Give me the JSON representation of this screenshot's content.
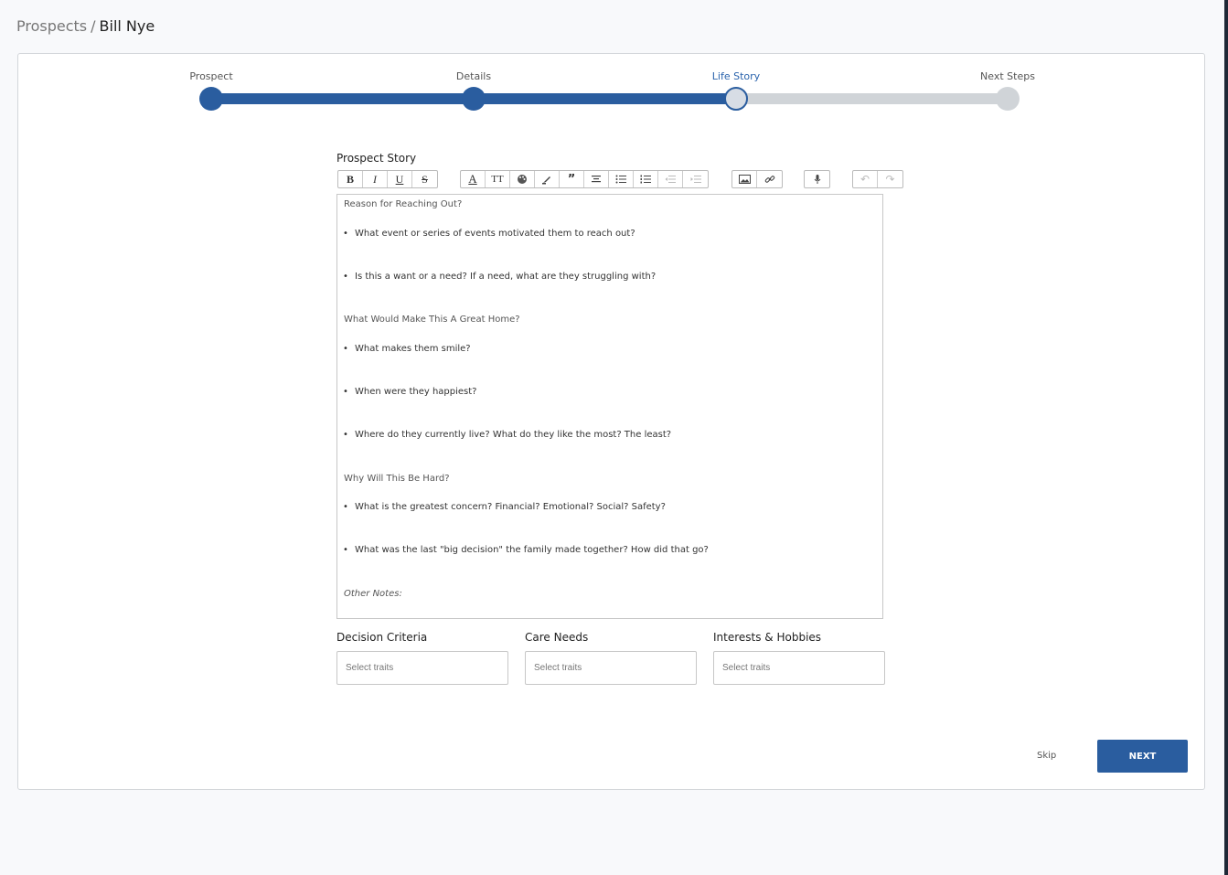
{
  "breadcrumb": {
    "root": "Prospects",
    "separator": "/",
    "current": "Bill Nye"
  },
  "stepper": {
    "steps": [
      {
        "label": "Prospect",
        "state": "done"
      },
      {
        "label": "Details",
        "state": "done"
      },
      {
        "label": "Life Story",
        "state": "current"
      },
      {
        "label": "Next Steps",
        "state": "todo"
      }
    ]
  },
  "editor": {
    "label": "Prospect Story",
    "toolbar": {
      "icons": [
        "bold-icon",
        "italic-icon",
        "underline-icon",
        "strikethrough-icon",
        "font-icon",
        "font-size-icon",
        "color-palette-icon",
        "highlight-icon",
        "blockquote-icon",
        "align-center-icon",
        "bulleted-list-icon",
        "numbered-list-icon",
        "outdent-icon",
        "indent-icon",
        "image-icon",
        "link-icon",
        "microphone-icon",
        "undo-icon",
        "redo-icon"
      ]
    },
    "content": {
      "heading_1": "Reason for Reaching Out?",
      "item_1": "What event or series of events motivated them to reach out?",
      "item_2": "Is this a want or a need?  If a need, what are they struggling with?",
      "heading_2": "What Would Make This A Great Home?",
      "item_3": "What makes them smile?",
      "item_4": "When were they happiest?",
      "item_5": "Where do they currently live?  What do they like the most?  The least?",
      "heading_3": "Why Will This Be Hard?",
      "item_6": "What is the greatest concern?  Financial?  Emotional?  Social?  Safety?",
      "item_7": "What was the last \"big decision\" the family made together?  How did that go?",
      "other_notes": "Other Notes:"
    }
  },
  "traits": {
    "decision_criteria": {
      "label": "Decision Criteria",
      "placeholder": "Select traits"
    },
    "care_needs": {
      "label": "Care Needs",
      "placeholder": "Select traits"
    },
    "interests": {
      "label": "Interests & Hobbies",
      "placeholder": "Select traits"
    }
  },
  "actions": {
    "skip": "Skip",
    "next": "NEXT"
  },
  "colors": {
    "accent": "#2a5d9f",
    "track_inactive": "#d0d4d8",
    "border": "#c7c7c7"
  }
}
